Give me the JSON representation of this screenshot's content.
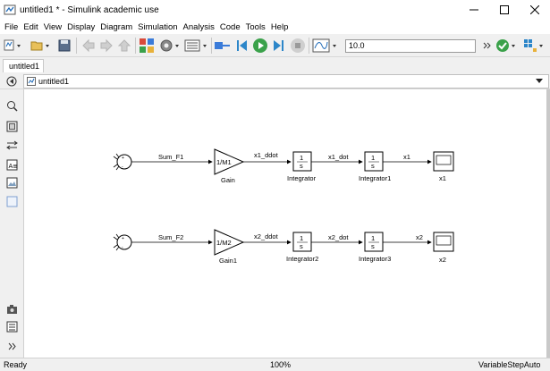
{
  "window": {
    "title": "untitled1 * - Simulink academic use"
  },
  "menu": [
    "File",
    "Edit",
    "View",
    "Display",
    "Diagram",
    "Simulation",
    "Analysis",
    "Code",
    "Tools",
    "Help"
  ],
  "toolbar": {
    "stop_time": "10.0"
  },
  "tabs": [
    {
      "label": "untitled1"
    }
  ],
  "address": {
    "path": "untitled1"
  },
  "diagram": {
    "row1": {
      "sum": "Sum_F1",
      "gain_text": "1/M1",
      "gain_name": "Gain",
      "sig_gain": "x1_ddot",
      "int_text": "1",
      "int_den": "s",
      "int_name": "Integrator",
      "sig_int": "x1_dot",
      "int2_text": "1",
      "int2_den": "s",
      "int2_name": "Integrator1",
      "sig_out": "x1",
      "scope_name": "x1"
    },
    "row2": {
      "sum": "Sum_F2",
      "gain_text": "1/M2",
      "gain_name": "Gain1",
      "sig_gain": "x2_ddot",
      "int_text": "1",
      "int_den": "s",
      "int_name": "Integrator2",
      "sig_int": "x2_dot",
      "int2_text": "1",
      "int2_den": "s",
      "int2_name": "Integrator3",
      "sig_out": "x2",
      "scope_name": "x2"
    }
  },
  "status": {
    "left": "Ready",
    "zoom": "100%",
    "solver": "VariableStepAuto"
  }
}
